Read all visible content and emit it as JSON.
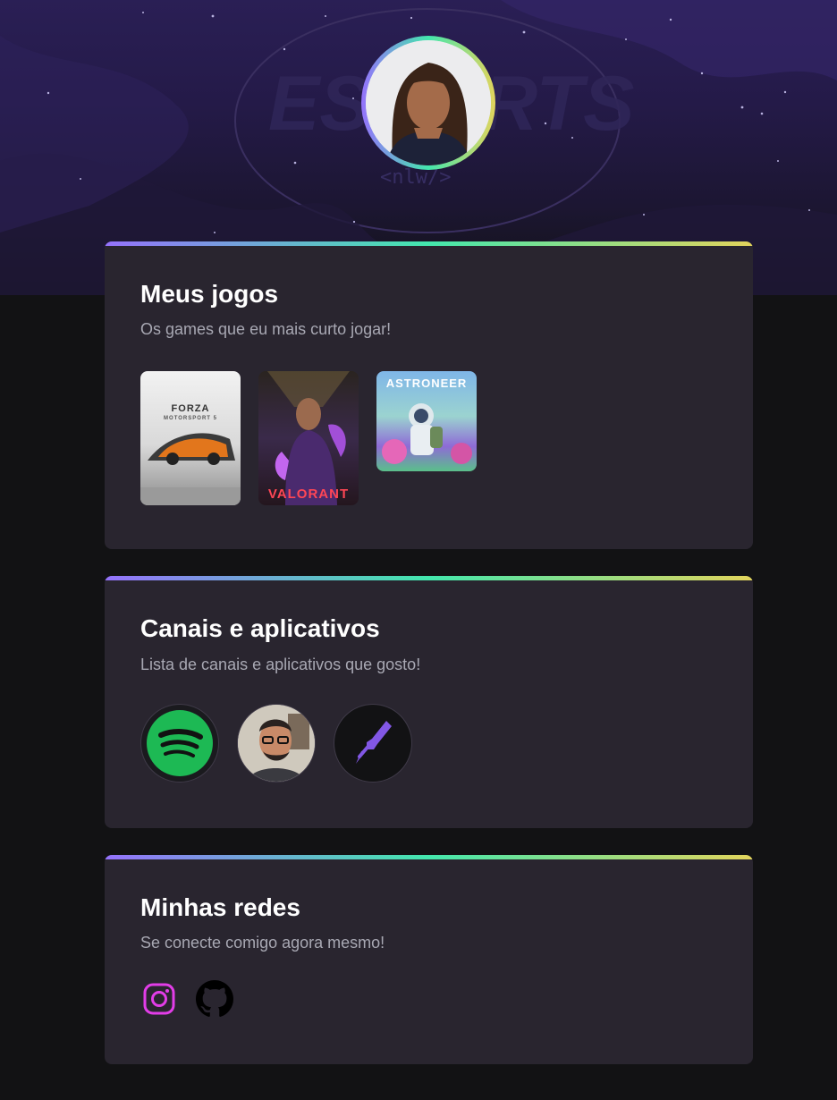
{
  "profile": {
    "avatar_alt": "Foto de perfil"
  },
  "sections": {
    "games": {
      "title": "Meus jogos",
      "subtitle": "Os games que eu mais curto jogar!",
      "items": [
        {
          "name": "FORZA",
          "sub": "MOTORSPORT 5"
        },
        {
          "name": "VALORANT"
        },
        {
          "name": "ASTRONEER"
        }
      ]
    },
    "apps": {
      "title": "Canais e aplicativos",
      "subtitle": "Lista de canais e aplicativos que gosto!",
      "items": [
        "spotify-icon",
        "channel-avatar",
        "rocketseat-icon"
      ]
    },
    "socials": {
      "title": "Minhas redes",
      "subtitle": "Se conecte comigo agora mesmo!",
      "items": [
        "instagram-icon",
        "github-icon"
      ]
    }
  },
  "colors": {
    "gradient": [
      "#9572fc",
      "#43e7ad",
      "#e2d45c"
    ],
    "card_bg": "#29252f",
    "page_bg": "#121214",
    "spotify_green": "#1db954",
    "instagram_pink": "#e23de8"
  }
}
